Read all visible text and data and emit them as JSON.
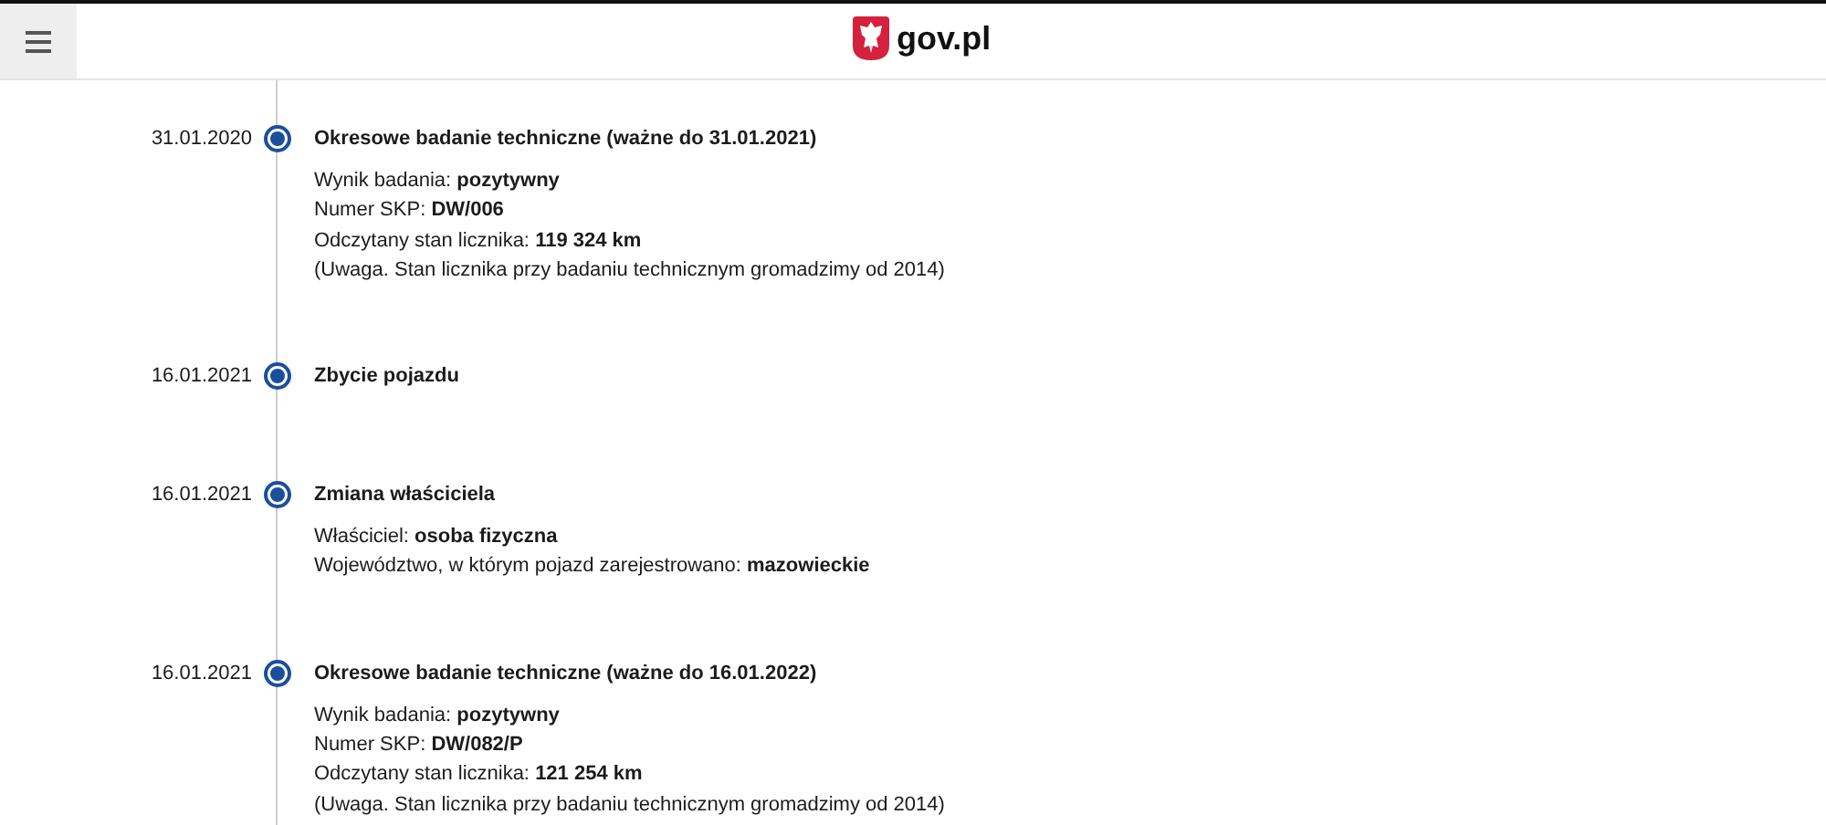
{
  "header": {
    "logo_text": "gov.pl"
  },
  "timeline": [
    {
      "date": "31.01.2020",
      "title": "Okresowe badanie techniczne (ważne do 31.01.2021)",
      "details": [
        "Wynik badania: **pozytywny**",
        "Numer SKP: **DW/006**",
        "Odczytany stan licznika: **119 324 km**",
        "(Uwaga. Stan licznika przy badaniu technicznym gromadzimy od 2014)"
      ]
    },
    {
      "date": "16.01.2021",
      "title": "Zbycie pojazdu"
    },
    {
      "date": "16.01.2021",
      "title": "Zmiana właściciela",
      "details": [
        "Właściciel: **osoba fizyczna**",
        "Województwo, w którym pojazd zarejestrowano: **mazowieckie**"
      ]
    },
    {
      "date": "16.01.2021",
      "title": "Okresowe badanie techniczne (ważne do 16.01.2022)",
      "details": [
        "Wynik badania: **pozytywny**",
        "Numer SKP: **DW/082/P**",
        "Odczytany stan licznika: **121 254 km**",
        "(Uwaga. Stan licznika przy badaniu technicznym gromadzimy od 2014)"
      ]
    }
  ]
}
